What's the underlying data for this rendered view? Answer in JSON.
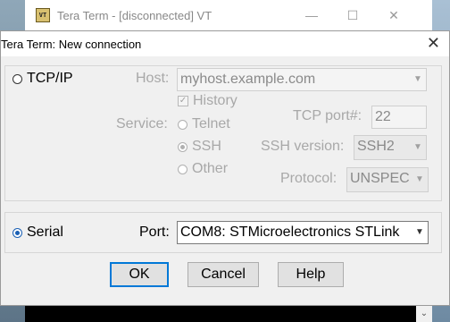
{
  "background_window": {
    "title": "Tera Term - [disconnected] VT",
    "icon_text": "VT",
    "min_glyph": "—",
    "max_glyph": "☐",
    "close_glyph": "✕",
    "scroll_glyph": "⌄"
  },
  "dialog": {
    "title": "Tera Term: New connection",
    "close_glyph": "✕",
    "tcp": {
      "label": "TCP/IP",
      "selected": false,
      "host_label": "Host:",
      "host_value": "myhost.example.com",
      "history_label": "History",
      "history_checked": true,
      "service_label": "Service:",
      "services": [
        {
          "label": "Telnet",
          "selected": false
        },
        {
          "label": "SSH",
          "selected": true
        },
        {
          "label": "Other",
          "selected": false
        }
      ],
      "tcp_port_label": "TCP port#:",
      "tcp_port_value": "22",
      "ssh_version_label": "SSH version:",
      "ssh_version_value": "SSH2",
      "protocol_label": "Protocol:",
      "protocol_value": "UNSPEC"
    },
    "serial": {
      "label": "Serial",
      "selected": true,
      "port_label": "Port:",
      "port_value": "COM8: STMicroelectronics STLink"
    },
    "buttons": {
      "ok": "OK",
      "cancel": "Cancel",
      "help": "Help"
    }
  },
  "colors": {
    "accent": "#0078d7",
    "radio_selected": "#1a5fb4"
  }
}
